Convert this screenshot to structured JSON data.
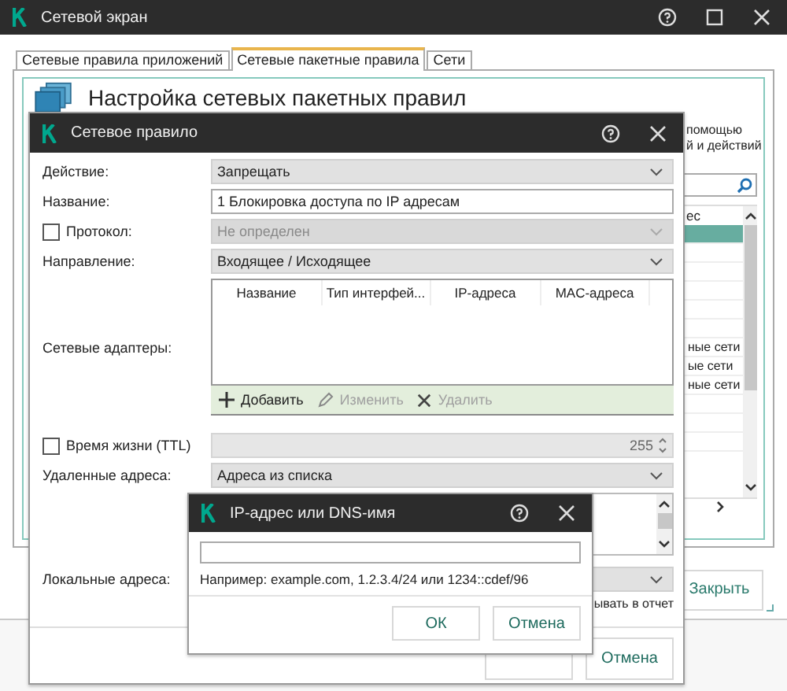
{
  "main_window": {
    "title": "Сетевой экран",
    "tabs": [
      {
        "label": "Сетевые правила приложений",
        "selected": false
      },
      {
        "label": "Сетевые пакетные правила",
        "selected": true
      },
      {
        "label": "Сети",
        "selected": false
      }
    ],
    "heading": "Настройка сетевых пакетных правил",
    "description_fragments": [
      "помощью",
      "й и действий"
    ],
    "table": {
      "column_fragment": "ес",
      "rows": [
        {
          "selected": true
        },
        {
          "selected": false
        },
        {
          "selected": false
        },
        {
          "selected": false
        },
        {
          "selected": false
        },
        {
          "selected": false
        },
        {
          "selected": false,
          "text": "ные сети"
        },
        {
          "selected": false,
          "text": "ые сети"
        },
        {
          "selected": false,
          "text": "ные сети"
        },
        {
          "selected": false
        },
        {
          "selected": false
        },
        {
          "selected": false
        }
      ]
    },
    "close_button": "Закрыть"
  },
  "rule_dialog": {
    "title": "Сетевое правило",
    "fields": [
      {
        "kind": "select",
        "label": "Действие:",
        "value": "Запрещать",
        "disabled": false
      },
      {
        "kind": "text",
        "label": "Название:",
        "value": "1 Блокировка доступа по IP адресам"
      },
      {
        "kind": "select",
        "label": "Протокол:",
        "checked": false,
        "value": "Не определен",
        "disabled": true
      },
      {
        "kind": "select",
        "label": "Направление:",
        "value": "Входящее / Исходящее",
        "disabled": false
      },
      {
        "kind": "table",
        "label": "Сетевые адаптеры:",
        "columns": [
          "Название",
          "Тип интерфей...",
          "IP-адреса",
          "MAC-адреса"
        ],
        "toolbar": [
          {
            "kind": "add",
            "label": "Добавить",
            "disabled": false
          },
          {
            "kind": "edit",
            "label": "Изменить",
            "disabled": true
          },
          {
            "kind": "delete",
            "label": "Удалить",
            "disabled": true
          }
        ]
      },
      {
        "kind": "spin",
        "label": "Время жизни (TTL)",
        "checked": false,
        "value": "255",
        "disabled": true
      },
      {
        "kind": "select",
        "label": "Удаленные адреса:",
        "value": "Адреса из списка",
        "disabled": false
      },
      {
        "kind": "list"
      },
      {
        "kind": "select",
        "label": "Локальные адреса:",
        "disabled": false
      },
      {
        "kind": "note",
        "value": "ывать в отчет"
      }
    ],
    "cancel_button": "Отмена"
  },
  "ip_dialog": {
    "title": "IP-адрес или DNS-имя",
    "hint": "Например: example.com, 1.2.3.4/24 или 1234::cdef/96",
    "buttons": [
      "ОК",
      "Отмена"
    ]
  }
}
